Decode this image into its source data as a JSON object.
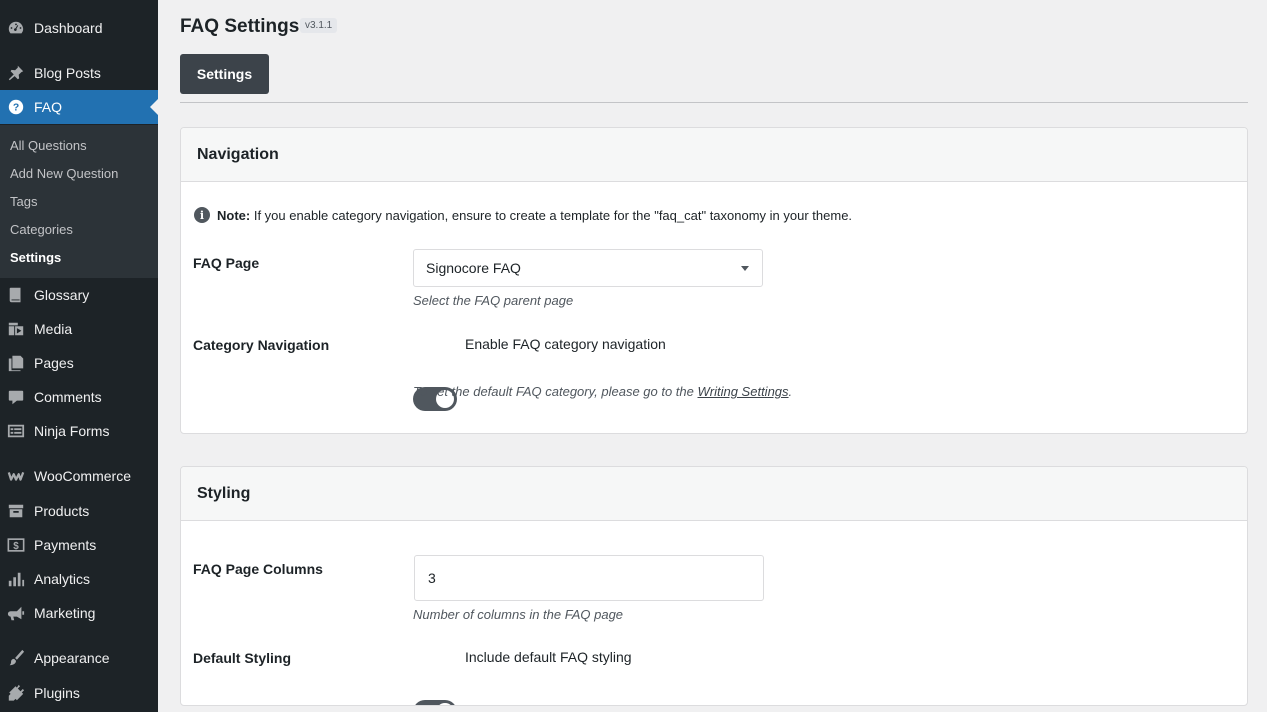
{
  "sidebar": {
    "top_items": [
      {
        "label": "Dashboard",
        "icon": "dashboard-icon"
      },
      {
        "label": "Blog Posts",
        "icon": "pin-icon"
      },
      {
        "label": "FAQ",
        "icon": "question-circle-icon"
      }
    ],
    "faq_submenu": [
      "All Questions",
      "Add New Question",
      "Tags",
      "Categories",
      "Settings"
    ],
    "current_submenu": "Settings",
    "lower_items": [
      {
        "label": "Glossary",
        "icon": "book-icon"
      },
      {
        "label": "Media",
        "icon": "media-icon"
      },
      {
        "label": "Pages",
        "icon": "pages-icon"
      },
      {
        "label": "Comments",
        "icon": "comment-icon"
      },
      {
        "label": "Ninja Forms",
        "icon": "form-icon"
      },
      {
        "label": "WooCommerce",
        "icon": "woocommerce-icon"
      },
      {
        "label": "Products",
        "icon": "archive-icon"
      },
      {
        "label": "Payments",
        "icon": "dollar-icon"
      },
      {
        "label": "Analytics",
        "icon": "bar-chart-icon"
      },
      {
        "label": "Marketing",
        "icon": "megaphone-icon"
      },
      {
        "label": "Appearance",
        "icon": "paintbrush-icon"
      },
      {
        "label": "Plugins",
        "icon": "plug-icon"
      }
    ],
    "active_color": "#2271b1"
  },
  "header": {
    "title": "FAQ Settings",
    "version": "v3.1.1",
    "tab": "Settings"
  },
  "navigation": {
    "title": "Navigation",
    "note_bold": "Note:",
    "note_text": "If you enable category navigation, ensure to create a template for the \"faq_cat\" taxonomy in your theme.",
    "faq_page_label": "FAQ Page",
    "faq_page_value": "Signocore FAQ",
    "faq_page_help": "Select the FAQ parent page",
    "category_nav_label": "Category Navigation",
    "category_nav_toggle": "Enable FAQ category navigation",
    "category_nav_on": true,
    "writing_text_before": "To set the default FAQ category, please go to the ",
    "writing_link": "Writing Settings",
    "writing_text_after": "."
  },
  "styling": {
    "title": "Styling",
    "columns_label": "FAQ Page Columns",
    "columns_value": "3",
    "columns_help": "Number of columns in the FAQ page",
    "default_styling_label": "Default Styling",
    "default_styling_toggle": "Include default FAQ styling",
    "default_styling_on": true
  }
}
